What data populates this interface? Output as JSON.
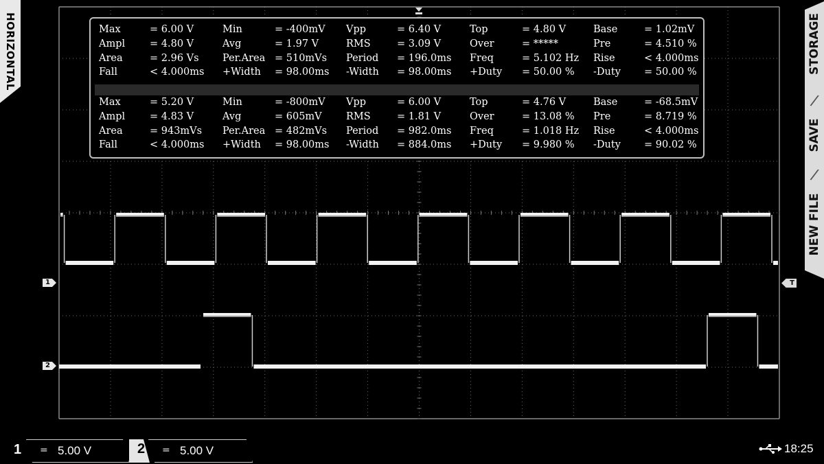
{
  "side_tabs": {
    "left": "HORIZONTAL",
    "right_items": [
      "STORAGE",
      "SAVE",
      "NEW FILE"
    ]
  },
  "measurements": {
    "ch1": [
      [
        [
          "Max",
          "= 6.00 V"
        ],
        [
          "Min",
          "= -400mV"
        ],
        [
          "Vpp",
          "= 6.40 V"
        ],
        [
          "Top",
          "= 4.80 V"
        ],
        [
          "Base",
          "= 1.02mV"
        ]
      ],
      [
        [
          "Ampl",
          "= 4.80 V"
        ],
        [
          "Avg",
          "= 1.97 V"
        ],
        [
          "RMS",
          "= 3.09 V"
        ],
        [
          "Over",
          "= *****"
        ],
        [
          "Pre",
          "= 4.510 %"
        ]
      ],
      [
        [
          "Area",
          "= 2.96 Vs"
        ],
        [
          "Per.Area",
          "= 510mVs"
        ],
        [
          "Period",
          "= 196.0ms"
        ],
        [
          "Freq",
          "= 5.102 Hz"
        ],
        [
          "Rise",
          "< 4.000ms"
        ]
      ],
      [
        [
          "Fall",
          "< 4.000ms"
        ],
        [
          "+Width",
          "= 98.00ms"
        ],
        [
          "-Width",
          "= 98.00ms"
        ],
        [
          "+Duty",
          "= 50.00 %"
        ],
        [
          "-Duty",
          "= 50.00 %"
        ]
      ]
    ],
    "ch2": [
      [
        [
          "Max",
          "= 5.20 V"
        ],
        [
          "Min",
          "= -800mV"
        ],
        [
          "Vpp",
          "= 6.00 V"
        ],
        [
          "Top",
          "= 4.76 V"
        ],
        [
          "Base",
          "= -68.5mV"
        ]
      ],
      [
        [
          "Ampl",
          "= 4.83 V"
        ],
        [
          "Avg",
          "= 605mV"
        ],
        [
          "RMS",
          "= 1.81 V"
        ],
        [
          "Over",
          "= 13.08 %"
        ],
        [
          "Pre",
          "= 8.719 %"
        ]
      ],
      [
        [
          "Area",
          "= 943mVs"
        ],
        [
          "Per.Area",
          "= 482mVs"
        ],
        [
          "Period",
          "= 982.0ms"
        ],
        [
          "Freq",
          "= 1.018 Hz"
        ],
        [
          "Rise",
          "< 4.000ms"
        ]
      ],
      [
        [
          "Fall",
          "< 4.000ms"
        ],
        [
          "+Width",
          "= 98.00ms"
        ],
        [
          "-Width",
          "= 884.0ms"
        ],
        [
          "+Duty",
          "= 9.980 %"
        ],
        [
          "-Duty",
          "= 90.02 %"
        ]
      ]
    ]
  },
  "markers": {
    "ch1": "1",
    "ch2": "2",
    "trigger": "T"
  },
  "bottom_bar": {
    "ch1": {
      "number": "1",
      "coupling": "=",
      "scale": "5.00 V"
    },
    "ch2": {
      "number": "2",
      "coupling": "=",
      "scale": "5.00 V"
    },
    "time": "18:25"
  },
  "waveforms": {
    "ch1_period_ms": 196.0,
    "ch1_duty_percent": 50.0,
    "ch2_period_ms": 982.0,
    "ch2_duty_percent": 9.98
  },
  "colors": {
    "trace": "#ffffff",
    "grid": "#6a6a6a",
    "panel_border": "#bfbfbf"
  }
}
